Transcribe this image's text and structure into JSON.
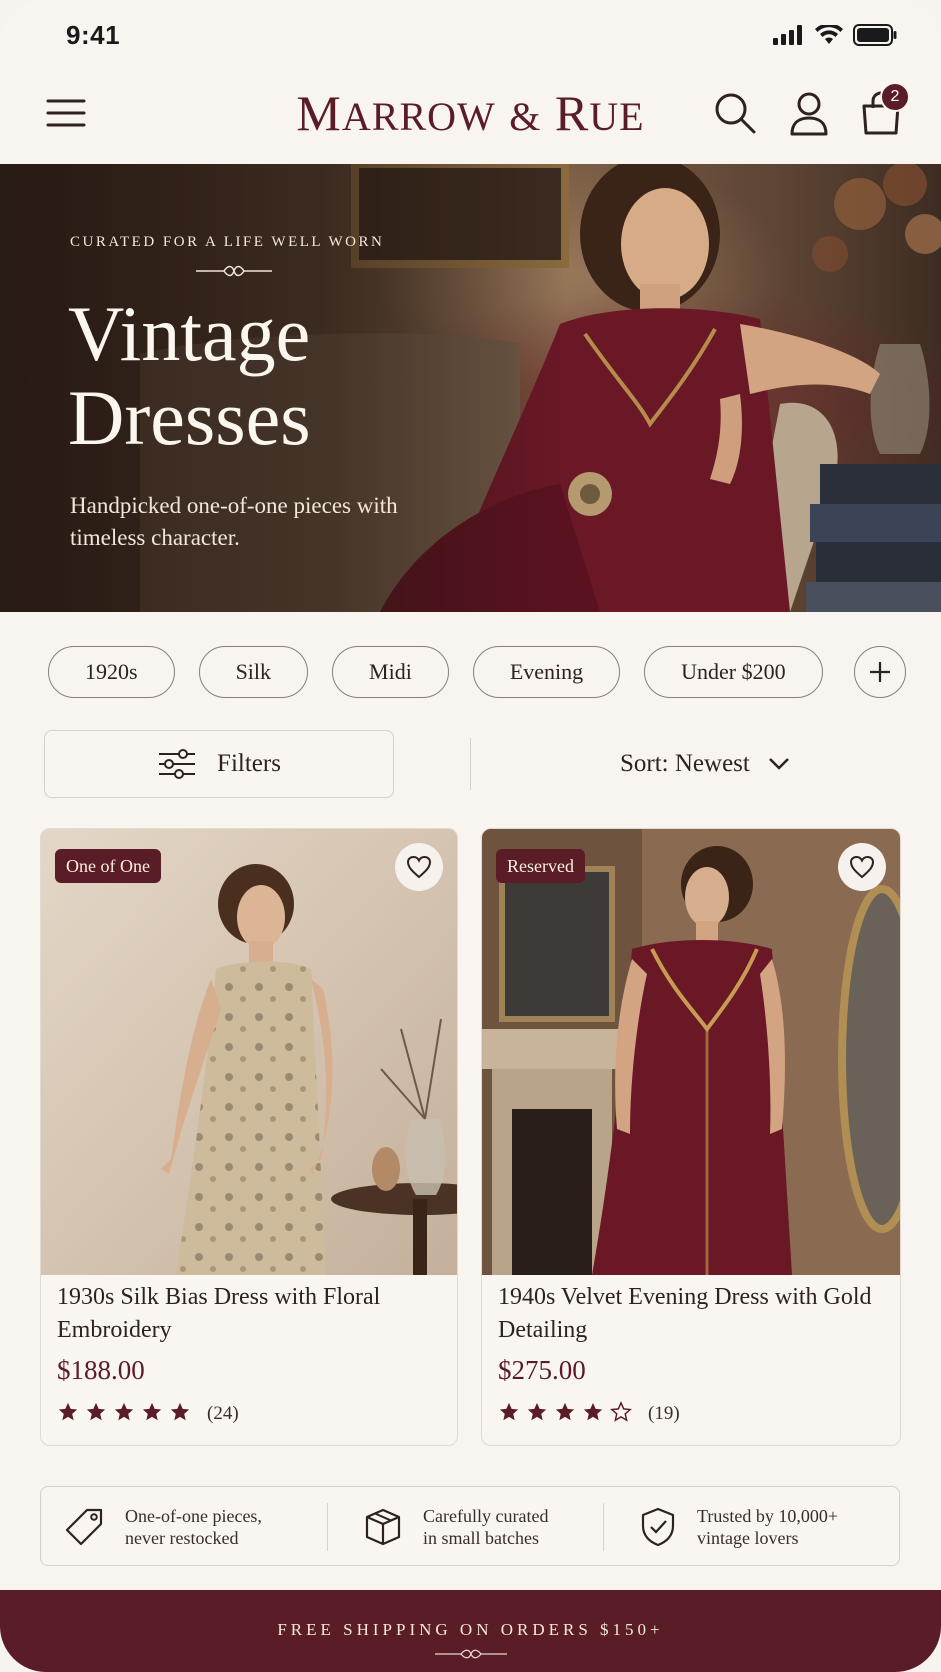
{
  "status": {
    "time": "9:41"
  },
  "header": {
    "logo_main_a": "M",
    "logo_small_a": "ARROW",
    "logo_amp": "&",
    "logo_main_b": "R",
    "logo_small_b": "UE",
    "cart_count": "2"
  },
  "hero": {
    "eyebrow": "CURATED FOR A LIFE WELL WORN",
    "title_line1": "Vintage",
    "title_line2": "Dresses",
    "subtitle": "Handpicked one-of-one pieces with timeless character."
  },
  "chips": [
    "1920s",
    "Silk",
    "Midi",
    "Evening",
    "Under $200"
  ],
  "toolbar": {
    "filters_label": "Filters",
    "sort_label": "Sort: Newest"
  },
  "products": [
    {
      "tag": "One of One",
      "title": "1930s Silk Bias Dress with Floral Embroidery",
      "price": "$188.00",
      "rating": 5,
      "reviews": "(24)"
    },
    {
      "tag": "Reserved",
      "title": "1940s Velvet Evening Dress with Gold Detailing",
      "price": "$275.00",
      "rating": 4,
      "reviews": "(19)"
    }
  ],
  "trust": [
    {
      "line1": "One-of-one pieces,",
      "line2": "never restocked",
      "icon": "tag-icon"
    },
    {
      "line1": "Carefully curated",
      "line2": "in small batches",
      "icon": "box-icon"
    },
    {
      "line1": "Trusted by 10,000+",
      "line2": "vintage lovers",
      "icon": "shield-check-icon"
    }
  ],
  "footer": {
    "banner": "FREE SHIPPING ON ORDERS $150+"
  },
  "colors": {
    "brand": "#5a1c26",
    "background": "#f8f4ef",
    "text": "#2e2220"
  }
}
